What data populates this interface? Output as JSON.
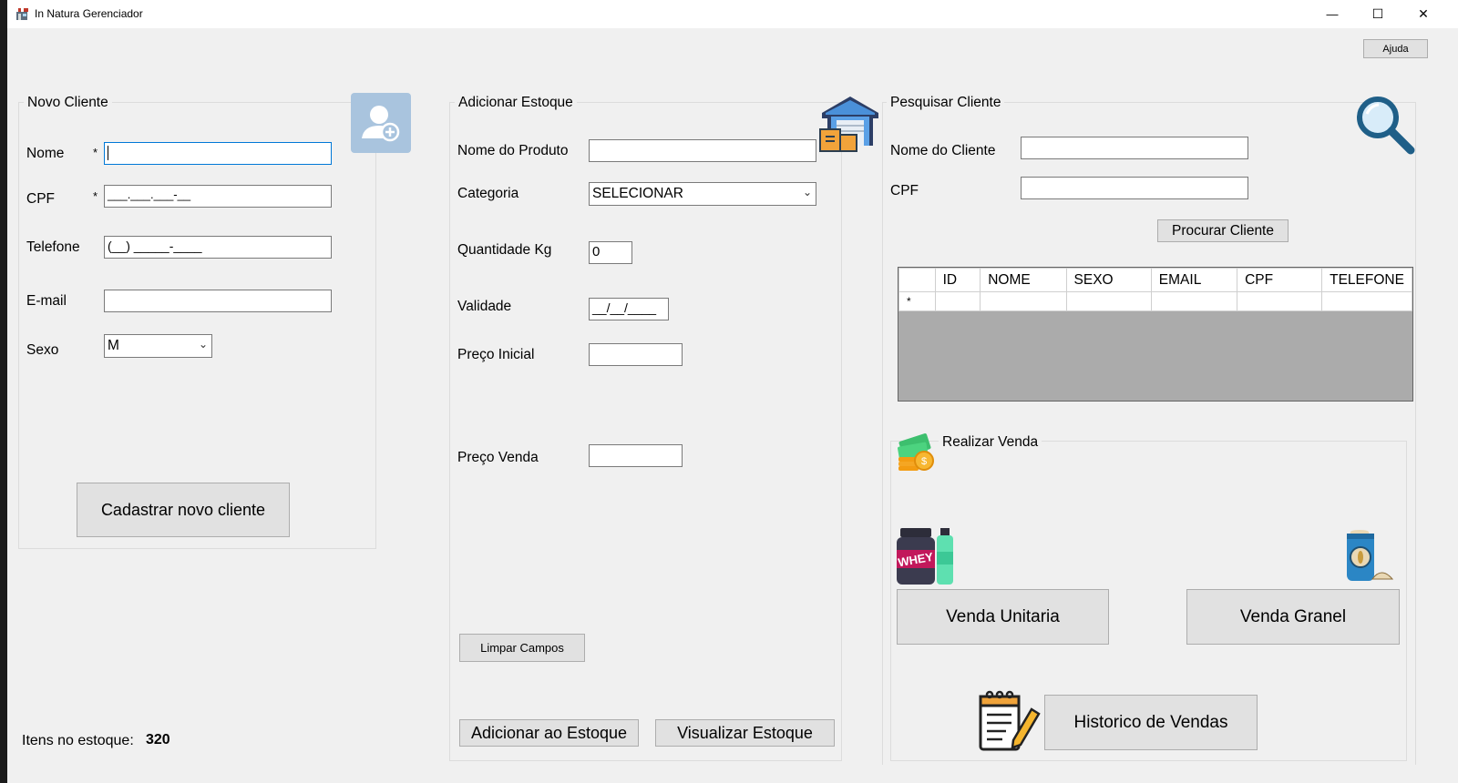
{
  "window": {
    "title": "In Natura Gerenciador",
    "minimize": "—",
    "maximize": "☐",
    "close": "✕",
    "help_button": "Ajuda"
  },
  "novo_cliente": {
    "group_title": "Novo Cliente",
    "nome_label": "Nome",
    "nome_value": "",
    "required_mark": "*",
    "cpf_label": "CPF",
    "cpf_mask": "___.___.___-__",
    "telefone_label": "Telefone",
    "telefone_mask": "(__) _____-____",
    "email_label": "E-mail",
    "email_value": "",
    "sexo_label": "Sexo",
    "sexo_value": "M",
    "submit_button": "Cadastrar novo cliente"
  },
  "estoque_info": {
    "label": "Itens no estoque:",
    "value": "320"
  },
  "adicionar_estoque": {
    "group_title": "Adicionar Estoque",
    "produto_label": "Nome do Produto",
    "produto_value": "",
    "categoria_label": "Categoria",
    "categoria_value": "SELECIONAR",
    "quantidade_label": "Quantidade Kg",
    "quantidade_value": "0",
    "validade_label": "Validade",
    "validade_mask": "__/__/____",
    "preco_inicial_label": "Preço Inicial",
    "preco_inicial_value": "",
    "preco_venda_label": "Preço Venda",
    "preco_venda_value": "",
    "clear_button": "Limpar Campos",
    "add_button": "Adicionar ao Estoque",
    "view_button": "Visualizar Estoque"
  },
  "pesquisar_cliente": {
    "group_title": "Pesquisar Cliente",
    "nome_label": "Nome do Cliente",
    "nome_value": "",
    "cpf_label": "CPF",
    "cpf_value": "",
    "search_button": "Procurar Cliente",
    "grid": {
      "columns": [
        "ID",
        "NOME",
        "SEXO",
        "EMAIL",
        "CPF",
        "TELEFONE"
      ],
      "new_row_marker": "*"
    }
  },
  "realizar_venda": {
    "group_title": "Realizar Venda",
    "unit_button": "Venda Unitaria",
    "bulk_button": "Venda Granel",
    "history_button": "Historico de Vendas"
  },
  "icons": {
    "app": "store-icon",
    "add_user": "add-user-icon",
    "warehouse": "warehouse-icon",
    "search": "magnifier-icon",
    "money": "money-icon",
    "whey": "whey-bottle-icon",
    "grain": "grain-sack-icon",
    "notepad": "notepad-icon"
  },
  "colors": {
    "window_bg": "#f0f0f0",
    "focus_border": "#0078d7",
    "grid_bg": "#ababab",
    "add_user_tile": "#a9c4de"
  }
}
